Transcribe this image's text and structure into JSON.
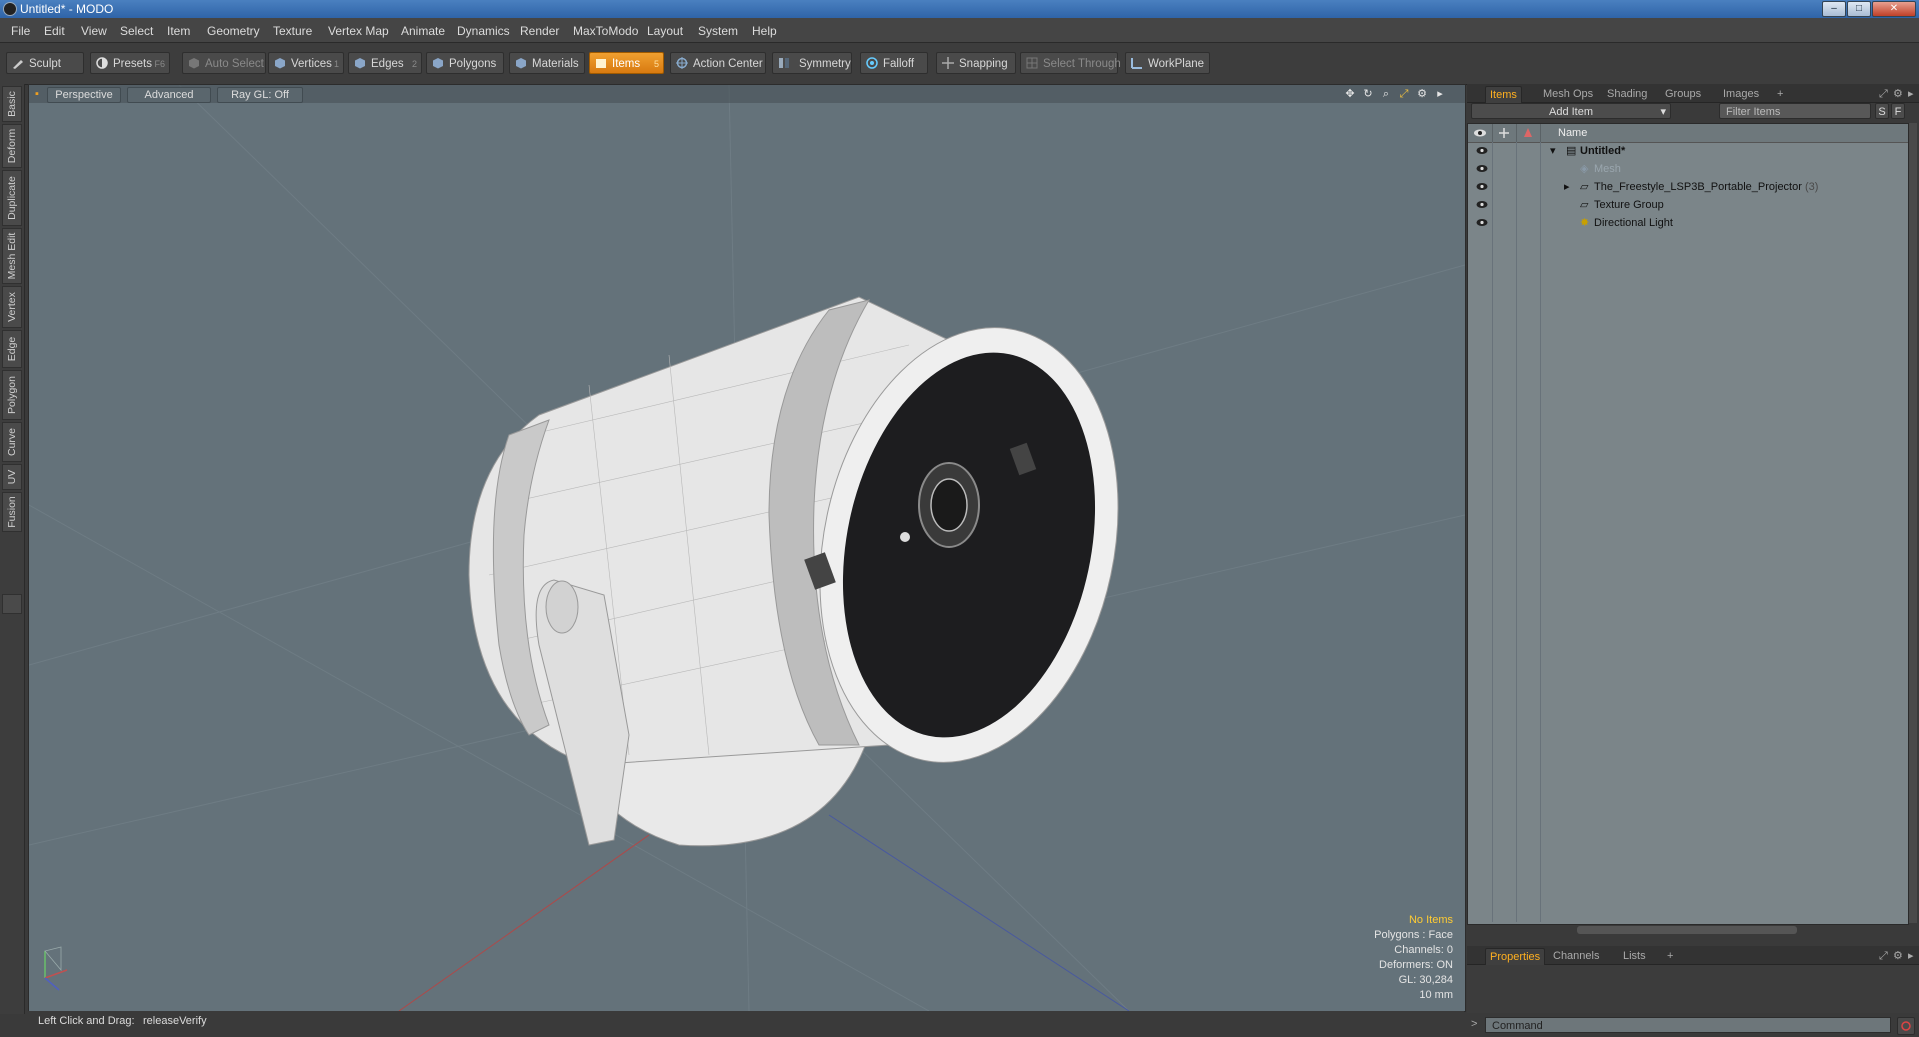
{
  "window": {
    "title": "Untitled* - MODO",
    "buttons": [
      "minimize",
      "maximize",
      "close"
    ]
  },
  "menu": [
    "File",
    "Edit",
    "View",
    "Select",
    "Item",
    "Geometry",
    "Texture",
    "Vertex Map",
    "Animate",
    "Dynamics",
    "Render",
    "MaxToModo",
    "Layout",
    "System",
    "Help"
  ],
  "toolbar": {
    "sculpt": "Sculpt",
    "presets": "Presets",
    "presets_key": "F6",
    "auto_select": "Auto Select",
    "vertices": "Vertices",
    "vertices_key": "1",
    "edges": "Edges",
    "edges_key": "2",
    "polygons": "Polygons",
    "materials": "Materials",
    "items": "Items",
    "items_key": "5",
    "action_center": "Action Center",
    "symmetry": "Symmetry",
    "falloff": "Falloff",
    "snapping": "Snapping",
    "select_through": "Select Through",
    "workplane": "WorkPlane",
    "accent_color": "#e8901c"
  },
  "left_tabs": [
    "Basic",
    "Deform",
    "Duplicate",
    "Mesh Edit",
    "Vertex",
    "Edge",
    "Polygon",
    "Curve",
    "UV",
    "Fusion"
  ],
  "viewport": {
    "view": "Perspective",
    "style": "Advanced",
    "raygl": "Ray GL: Off",
    "stats": {
      "selection": "No Items",
      "polygons": "Polygons : Face",
      "channels": "Channels: 0",
      "deformers": "Deformers: ON",
      "gl": "GL: 30,284",
      "scale": "10 mm"
    },
    "icons": [
      "move-view-icon",
      "rotate-view-icon",
      "zoom-view-icon",
      "maximize-view-icon",
      "settings-icon",
      "more-arrow-icon"
    ]
  },
  "status": {
    "hint": "Left Click and Drag:",
    "action": "releaseVerify"
  },
  "items_panel": {
    "tabs": [
      "Items",
      "Mesh Ops",
      "Shading",
      "Groups",
      "Images",
      "+"
    ],
    "add_item": "Add Item",
    "filter": "Filter Items",
    "s_btn": "S",
    "f_btn": "F",
    "name_col": "Name",
    "rows": [
      {
        "label": "Untitled*",
        "icon": "scene-icon",
        "bold": true
      },
      {
        "label": "Mesh",
        "icon": "mesh-icon",
        "dim": true
      },
      {
        "label": "The_Freestyle_LSP3B_Portable_Projector",
        "count": "(3)",
        "icon": "group-icon"
      },
      {
        "label": "Texture Group",
        "icon": "texture-group-icon"
      },
      {
        "label": "Directional Light",
        "icon": "light-icon"
      }
    ]
  },
  "properties_panel": {
    "tabs": [
      "Properties",
      "Channels",
      "Lists",
      "+"
    ],
    "command_placeholder": "Command"
  }
}
